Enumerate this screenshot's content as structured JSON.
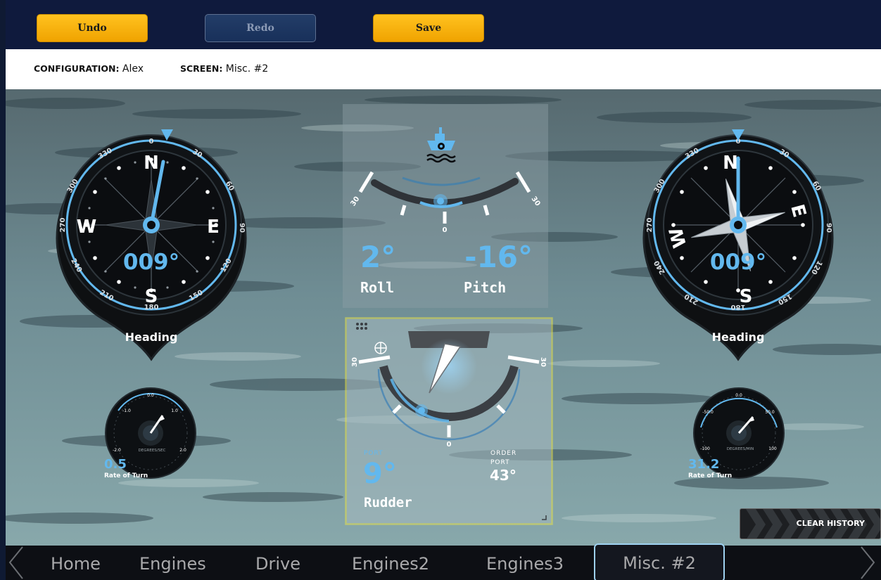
{
  "toolbar": {
    "undo_label": "Undo",
    "redo_label": "Redo",
    "save_label": "Save"
  },
  "config": {
    "configuration_label": "CONFIGURATION:",
    "configuration_value": "Alex",
    "screen_label": "SCREEN:",
    "screen_value": "Misc. #2"
  },
  "heading_left": {
    "value": "009°",
    "label": "Heading",
    "cardinals": [
      "N",
      "E",
      "S",
      "W"
    ],
    "ticks": [
      "0",
      "30",
      "60",
      "90",
      "120",
      "150",
      "180",
      "210",
      "240",
      "270",
      "300",
      "330"
    ]
  },
  "heading_right": {
    "value": "009°",
    "label": "Heading",
    "cardinals": [
      "N",
      "E",
      "S",
      "W"
    ],
    "ticks": [
      "0",
      "30",
      "60",
      "90",
      "120",
      "150",
      "180",
      "210",
      "240",
      "270",
      "300",
      "330"
    ]
  },
  "attitude": {
    "roll_value": "2°",
    "roll_label": "Roll",
    "pitch_value": "-16°",
    "pitch_label": "Pitch",
    "scale_left": "30",
    "scale_right": "30",
    "scale_center": "0"
  },
  "rudder": {
    "side": "PORT",
    "value": "9°",
    "label": "Rudder",
    "order_label": "ORDER",
    "order_side": "PORT",
    "order_value": "43°",
    "scale_left": "30",
    "scale_right": "30",
    "scale_center": "0"
  },
  "rot_left": {
    "value": "0.5",
    "label": "Rate of Turn",
    "units": "DEGREES/SEC",
    "ticks": [
      "0.0",
      "1.0",
      "2.0",
      "-1.0",
      "-2.0"
    ]
  },
  "rot_right": {
    "value": "31.2",
    "label": "Rate of Turn",
    "units": "DEGREES/MIN",
    "ticks": [
      "0.0",
      "50.0",
      "100",
      "-50.0",
      "-100"
    ]
  },
  "clear_history_label": "CLEAR HISTORY",
  "nav_tabs": [
    "Home",
    "Engines",
    "Drive",
    "Engines2",
    "Engines3",
    "Misc. #2"
  ],
  "colors": {
    "accent_blue": "#62b8ee",
    "button_yellow": "#f5a800",
    "topbar_navy": "#0f1a3d",
    "selection_yellow": "#e8e24a"
  }
}
